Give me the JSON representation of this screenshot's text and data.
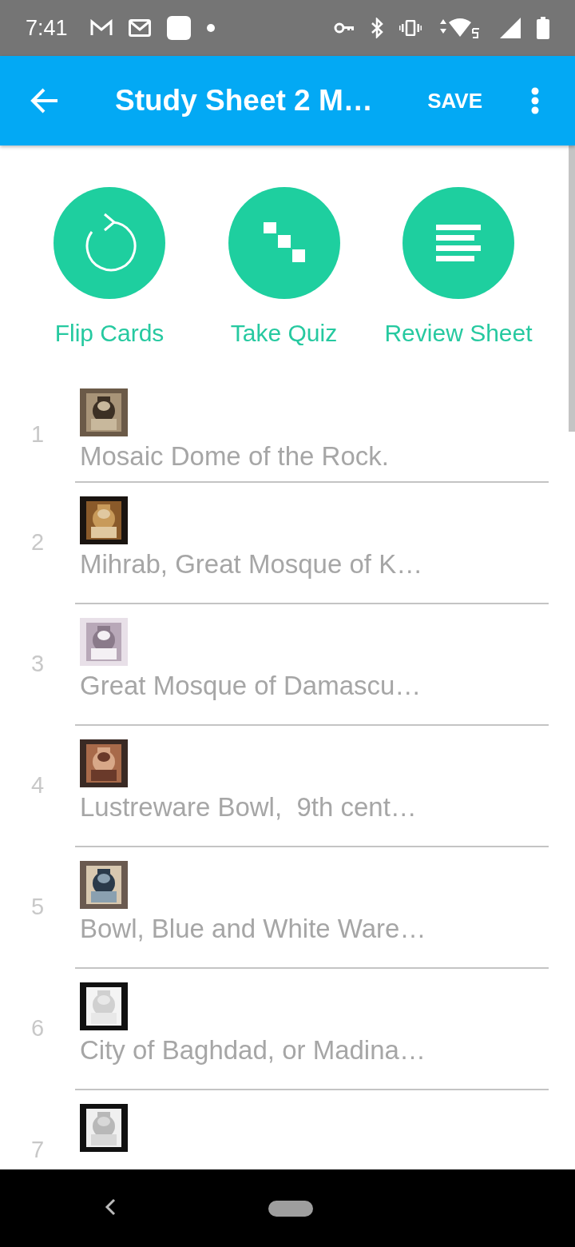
{
  "status_bar": {
    "time": "7:41"
  },
  "app_bar": {
    "title": "Study Sheet 2 M…",
    "action": "SAVE"
  },
  "modes": [
    {
      "label": "Flip Cards",
      "kind": "flip"
    },
    {
      "label": "Take Quiz",
      "kind": "quiz"
    },
    {
      "label": "Review Sheet",
      "kind": "review"
    }
  ],
  "items": [
    {
      "number": "1",
      "title": "Mosaic Dome of the Rock."
    },
    {
      "number": "2",
      "title": "Mihrab, Great Mosque of K…"
    },
    {
      "number": "3",
      "title": "Great Mosque of Damascu…"
    },
    {
      "number": "4",
      "title": "Lustreware Bowl,  9th cent…"
    },
    {
      "number": "5",
      "title": "Bowl, Blue and White Ware…"
    },
    {
      "number": "6",
      "title": "City of Baghdad, or Madina…"
    },
    {
      "number": "7"
    }
  ]
}
